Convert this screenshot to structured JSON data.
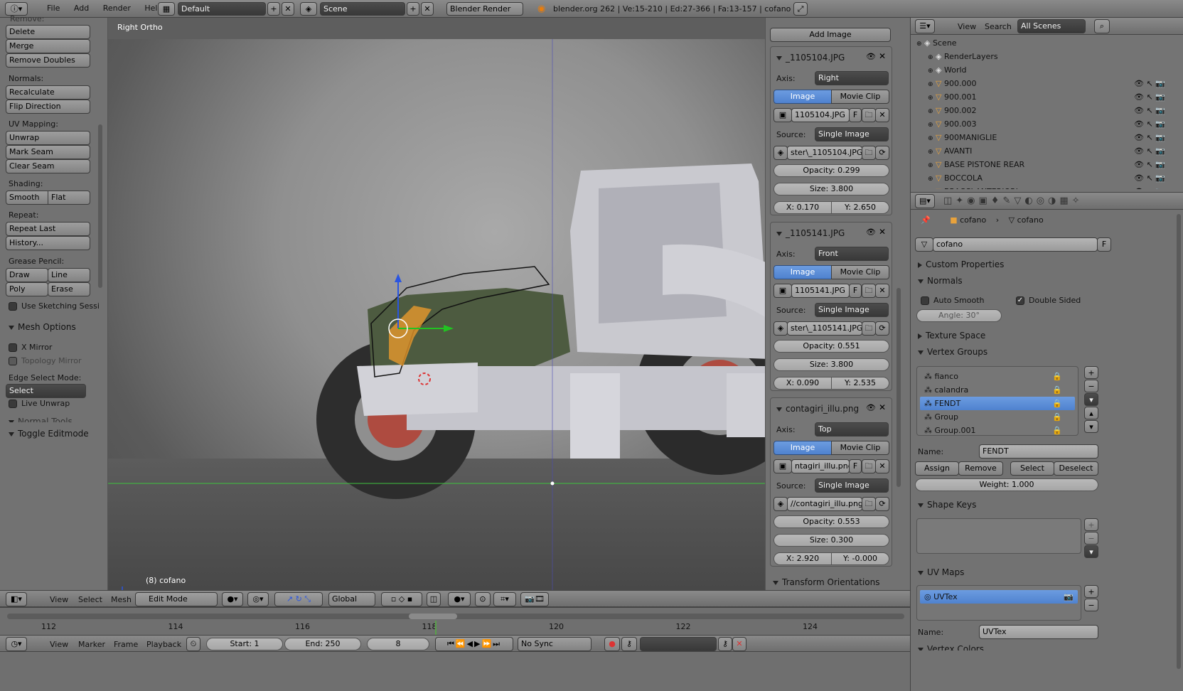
{
  "colors": {
    "accent": "#5680c2",
    "bg": "#727272",
    "viewport": "#5e5e5e",
    "orange": "#f29c2b"
  },
  "topbar": {
    "menu": [
      "File",
      "Add",
      "Render",
      "Help"
    ],
    "layout": "Default",
    "scene": "Scene",
    "engine": "Blender Render",
    "stats": "blender.org 262 | Ve:15-210 | Ed:27-366 | Fa:13-157 | cofano"
  },
  "toolshelf": {
    "top_cut": "Remove:",
    "remove_buttons": [
      "Delete",
      "Merge",
      "Remove Doubles"
    ],
    "normals_label": "Normals:",
    "normals_buttons": [
      "Recalculate",
      "Flip Direction"
    ],
    "uv_label": "UV Mapping:",
    "uv_buttons": [
      "Unwrap",
      "Mark Seam",
      "Clear Seam"
    ],
    "shading_label": "Shading:",
    "shading": [
      "Smooth",
      "Flat"
    ],
    "repeat_label": "Repeat:",
    "repeat_buttons": [
      "Repeat Last",
      "History..."
    ],
    "grease_label": "Grease Pencil:",
    "grease": [
      "Draw",
      "Line",
      "Poly",
      "Erase"
    ],
    "sketch": "Use Sketching Sessi",
    "mesh_options": "Mesh Options",
    "x_mirror": "X Mirror",
    "topology_mirror": "Topology Mirror",
    "edge_select_label": "Edge Select Mode:",
    "edge_select": "Select",
    "live_unwrap": "Live Unwrap",
    "normal_tools_cut": "Normal Tools",
    "toggle_editmode": "Toggle Editmode"
  },
  "viewport": {
    "view_name": "Right Ortho",
    "object_label": "(8) cofano"
  },
  "bg_images": {
    "add_image": "Add Image",
    "images": [
      {
        "name": "_1105104.JPG",
        "axis_label": "Axis:",
        "axis": "Right",
        "tab_image": "Image",
        "tab_movie": "Movie Clip",
        "file": "1105104.JPG",
        "f": "F",
        "source_label": "Source:",
        "source": "Single Image",
        "path": "ster\\_1105104.JPG",
        "opacity": "Opacity: 0.299",
        "size": "Size: 3.800",
        "x": "X: 0.170",
        "y": "Y: 2.650"
      },
      {
        "name": "_1105141.JPG",
        "axis_label": "Axis:",
        "axis": "Front",
        "tab_image": "Image",
        "tab_movie": "Movie Clip",
        "file": "1105141.JPG",
        "f": "F",
        "source_label": "Source:",
        "source": "Single Image",
        "path": "ster\\_1105141.JPG",
        "opacity": "Opacity: 0.551",
        "size": "Size: 3.800",
        "x": "X: 0.090",
        "y": "Y: 2.535"
      },
      {
        "name": "contagiri_illu.png",
        "axis_label": "Axis:",
        "axis": "Top",
        "tab_image": "Image",
        "tab_movie": "Movie Clip",
        "file": "ntagiri_illu.png",
        "f": "F",
        "source_label": "Source:",
        "source": "Single Image",
        "path": "//contagiri_illu.png",
        "opacity": "Opacity: 0.553",
        "size": "Size: 0.300",
        "x": "X: 2.920",
        "y": "Y: -0.000"
      }
    ],
    "transform_orientations": "Transform Orientations"
  },
  "outliner": {
    "menu": [
      "View",
      "Search"
    ],
    "scenes": "All Scenes",
    "rows": [
      "Scene",
      "RenderLayers",
      "World",
      "900.000",
      "900.001",
      "900.002",
      "900.003",
      "900MANIGLIE",
      "AVANTI",
      "BASE PISTONE REAR",
      "BOCCOLA",
      "BRACCI ANTERIORI"
    ]
  },
  "properties": {
    "breadcrumb": [
      "cofano",
      "cofano"
    ],
    "mesh_name": "cofano",
    "mesh_f": "F",
    "custom_props": "Custom Properties",
    "normals": "Normals",
    "auto_smooth": "Auto Smooth",
    "double_sided": "Double Sided",
    "angle": "Angle: 30°",
    "texture_space": "Texture Space",
    "vertex_groups": "Vertex Groups",
    "groups": [
      "fianco",
      "calandra",
      "FENDT",
      "Group",
      "Group.001"
    ],
    "selected_group": "FENDT",
    "name_label": "Name:",
    "group_name": "FENDT",
    "vg_buttons": [
      "Assign",
      "Remove",
      "Select",
      "Deselect"
    ],
    "weight": "Weight: 1.000",
    "shape_keys": "Shape Keys",
    "uv_maps": "UV Maps",
    "uvtex": "UVTex",
    "uv_name_label": "Name:",
    "uv_name": "UVTex",
    "vertex_colors": "Vertex Colors"
  },
  "view3d_header": {
    "menu": [
      "View",
      "Select",
      "Mesh"
    ],
    "mode": "Edit Mode",
    "orientation": "Global"
  },
  "timeline": {
    "ticks": [
      "112",
      "114",
      "116",
      "118",
      "120",
      "122",
      "124"
    ],
    "menu": [
      "View",
      "Marker",
      "Frame",
      "Playback"
    ],
    "start": "Start: 1",
    "end": "End: 250",
    "frame": "8",
    "sync": "No Sync"
  }
}
